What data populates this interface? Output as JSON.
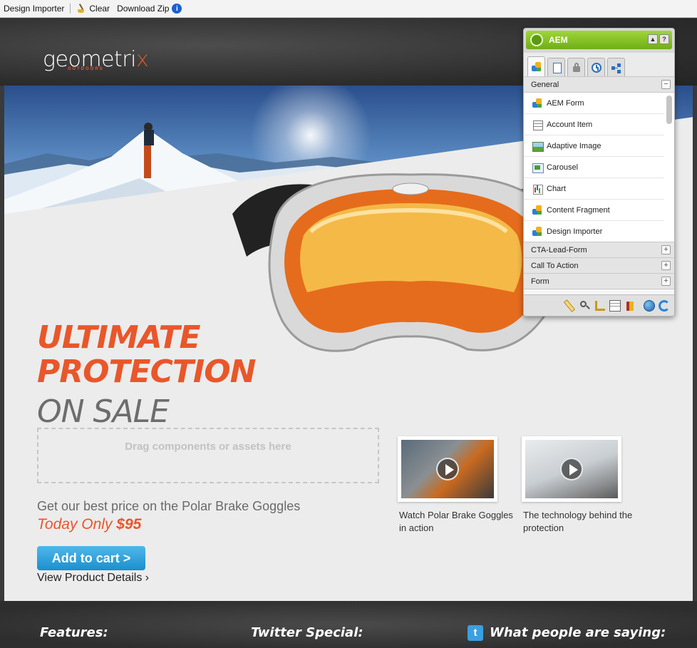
{
  "toolbar": {
    "design_importer": "Design Importer",
    "clear": "Clear",
    "download_zip": "Download Zip",
    "info": "i"
  },
  "brand": {
    "name_part1": "geometri",
    "name_x": "x",
    "tagline": "OUTDOORS",
    "accent_color": "#e8572a"
  },
  "hero": {
    "line1": "ULTIMATE",
    "line2": "PROTECTION",
    "line3": "ON SALE",
    "dropzone": "Drag components or assets here",
    "promo": "Get our best price on the Polar Brake Goggles",
    "today_prefix": "Today Only ",
    "price": "$95",
    "cart_button": "Add to cart  >",
    "details_link": "View Product Details ›"
  },
  "videos": [
    {
      "caption": "Watch Polar Brake Goggles in action"
    },
    {
      "caption": "The technology behind the protection"
    }
  ],
  "footer": {
    "features": "Features:",
    "twitter": "Twitter Special:",
    "people": "What people are saying:",
    "twitter_icon": "t"
  },
  "sidekick": {
    "title": "AEM",
    "minimize": "▲",
    "help": "?",
    "tabs": [
      "components-tab",
      "page-tab",
      "lock-tab",
      "versioning-tab",
      "workflow-tab"
    ],
    "general_label": "General",
    "general_toggle": "−",
    "items": [
      {
        "label": "AEM Form",
        "icon": "component-icon"
      },
      {
        "label": "Account Item",
        "icon": "account-item-icon"
      },
      {
        "label": "Adaptive Image",
        "icon": "image-icon"
      },
      {
        "label": "Carousel",
        "icon": "carousel-icon"
      },
      {
        "label": "Chart",
        "icon": "chart-icon"
      },
      {
        "label": "Content Fragment",
        "icon": "component-icon"
      },
      {
        "label": "Design Importer",
        "icon": "component-icon"
      }
    ],
    "groups": [
      {
        "label": "CTA-Lead-Form",
        "toggle": "+"
      },
      {
        "label": "Call To Action",
        "toggle": "+"
      },
      {
        "label": "Form",
        "toggle": "+"
      }
    ],
    "footer_icons": [
      "edit-mode-icon",
      "preview-icon",
      "design-icon",
      "page-properties-icon",
      "delete-icon",
      "publish-icon",
      "reload-icon"
    ],
    "green": "#8cc63f"
  }
}
